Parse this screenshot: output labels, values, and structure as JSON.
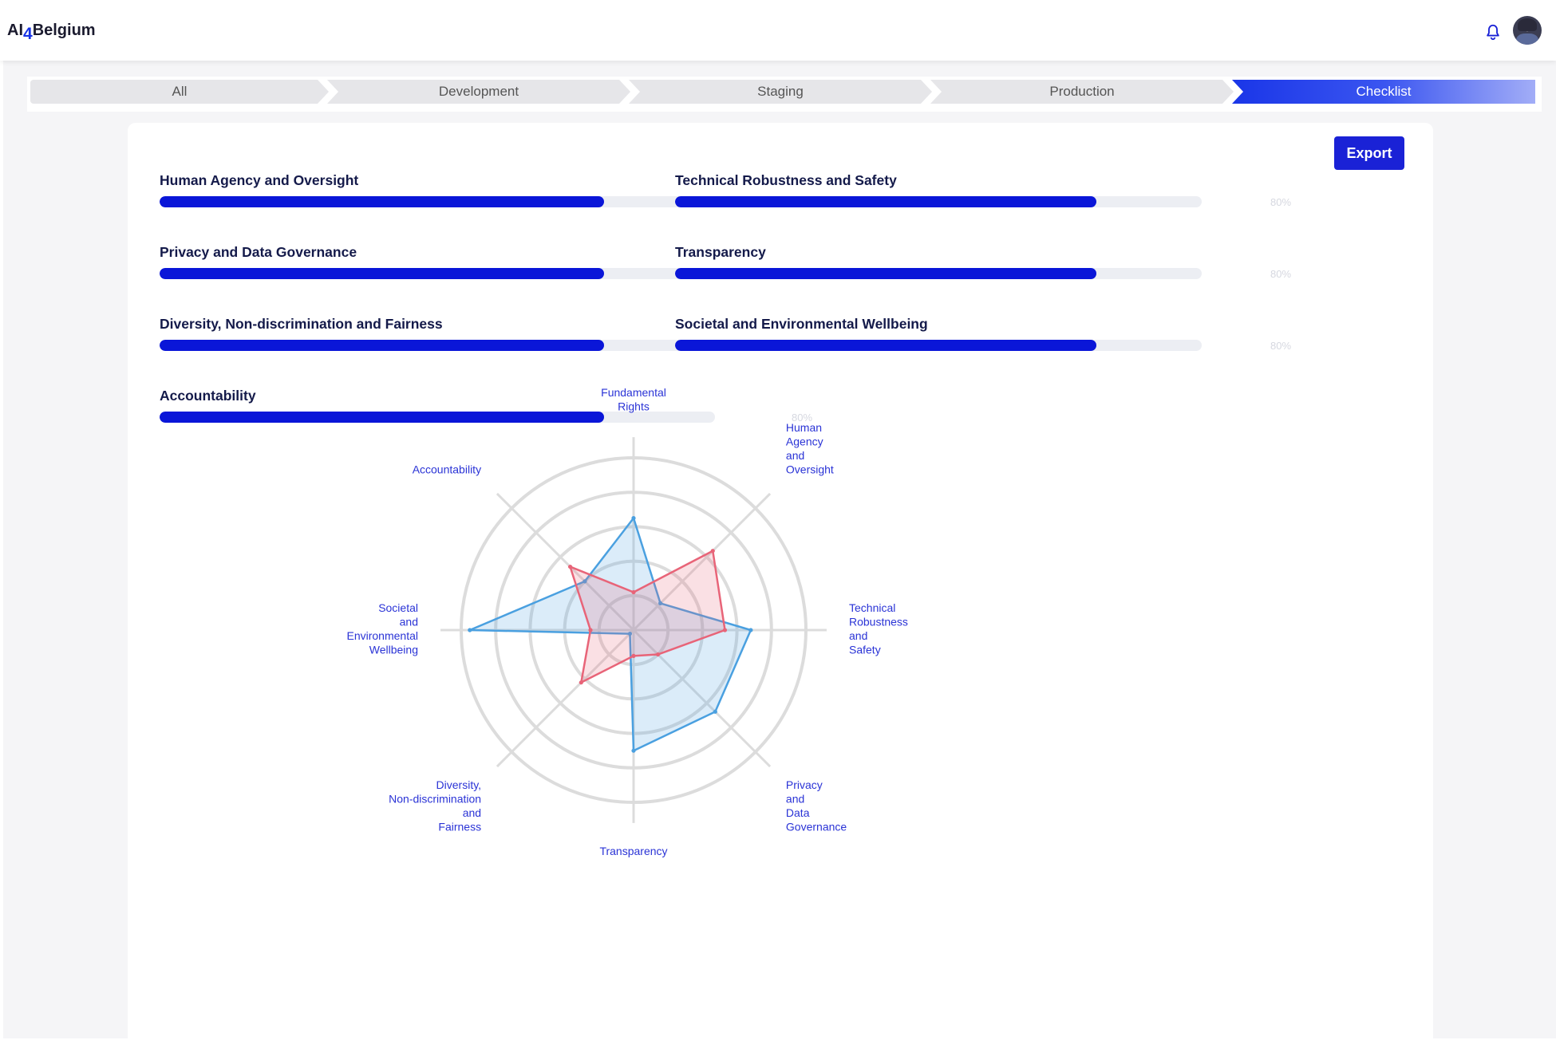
{
  "app": {
    "logo": {
      "prefix": "AI",
      "sub": "4",
      "suffix": "Belgium"
    }
  },
  "header": {
    "icons": [
      "bell-icon",
      "avatar"
    ]
  },
  "stepper": {
    "steps": [
      {
        "label": "All",
        "active": false
      },
      {
        "label": "Development",
        "active": false
      },
      {
        "label": "Staging",
        "active": false
      },
      {
        "label": "Production",
        "active": false
      },
      {
        "label": "Checklist",
        "active": true
      }
    ]
  },
  "toolbar": {
    "export_label": "Export"
  },
  "requirements": [
    {
      "label": "Human Agency and Oversight",
      "percent_text": "80%",
      "value": 0.8
    },
    {
      "label": "Technical Robustness and Safety",
      "percent_text": "80%",
      "value": 0.8
    },
    {
      "label": "Privacy and Data Governance",
      "percent_text": "80%",
      "value": 0.8
    },
    {
      "label": "Transparency",
      "percent_text": "80%",
      "value": 0.8
    },
    {
      "label": "Diversity, Non-discrimination and Fairness",
      "percent_text": "80%",
      "value": 0.8
    },
    {
      "label": "Societal and Environmental Wellbeing",
      "percent_text": "80%",
      "value": 0.8
    },
    {
      "label": "Accountability",
      "percent_text": "80%",
      "value": 0.8
    }
  ],
  "colors": {
    "accent": "#1a22d6",
    "progress_fill": "#0a16d8",
    "series_blue": "#4aa0e0",
    "series_red": "#e86478",
    "axis_label": "#2a33d6"
  },
  "chart_data": {
    "type": "radar",
    "axes": [
      [
        "Fundamental",
        "Rights"
      ],
      [
        "Human",
        "Agency",
        "and",
        "Oversight"
      ],
      [
        "Technical",
        "Robustness",
        "and",
        "Safety"
      ],
      [
        "Privacy",
        "and",
        "Data",
        "Governance"
      ],
      [
        "Transparency"
      ],
      [
        "Diversity,",
        "Non-discrimination",
        "and",
        "Fairness"
      ],
      [
        "Societal",
        "and",
        "Environmental",
        "Wellbeing"
      ],
      [
        "Accountability"
      ]
    ],
    "rlim": [
      0,
      100
    ],
    "rings": [
      20,
      40,
      60,
      80,
      100
    ],
    "grid": true,
    "series": [
      {
        "values": [
          65,
          22,
          68,
          67,
          70,
          3,
          95,
          40
        ],
        "color": "#4aa0e0"
      },
      {
        "values": [
          22,
          65,
          53,
          20,
          15,
          43,
          25,
          52
        ],
        "color": "#e86478"
      }
    ]
  }
}
